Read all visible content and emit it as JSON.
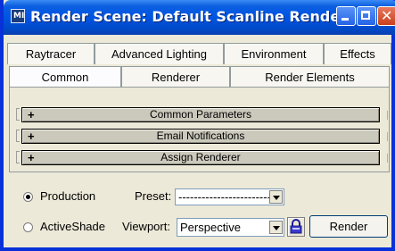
{
  "window": {
    "title": "Render Scene: Default Scanline Rende..."
  },
  "tabs_row1": [
    {
      "label": "Raytracer"
    },
    {
      "label": "Advanced Lighting"
    },
    {
      "label": "Environment"
    },
    {
      "label": "Effects"
    }
  ],
  "tabs_row2": [
    {
      "label": "Common",
      "active": true
    },
    {
      "label": "Renderer"
    },
    {
      "label": "Render Elements"
    }
  ],
  "rollouts": [
    {
      "label": "Common Parameters"
    },
    {
      "label": "Email Notifications"
    },
    {
      "label": "Assign Renderer"
    }
  ],
  "render_mode": {
    "production_label": "Production",
    "activeshade_label": "ActiveShade",
    "selected": "Production"
  },
  "preset": {
    "label": "Preset:",
    "value": "------------------------"
  },
  "viewport": {
    "label": "Viewport:",
    "value": "Perspective"
  },
  "render_button": {
    "label": "Render"
  },
  "icons": {
    "app": "app-icon",
    "lock": "lock-icon"
  },
  "colors": {
    "titlebar": "#0054e3",
    "background": "#ece9d8",
    "accent": "#0831d9"
  }
}
